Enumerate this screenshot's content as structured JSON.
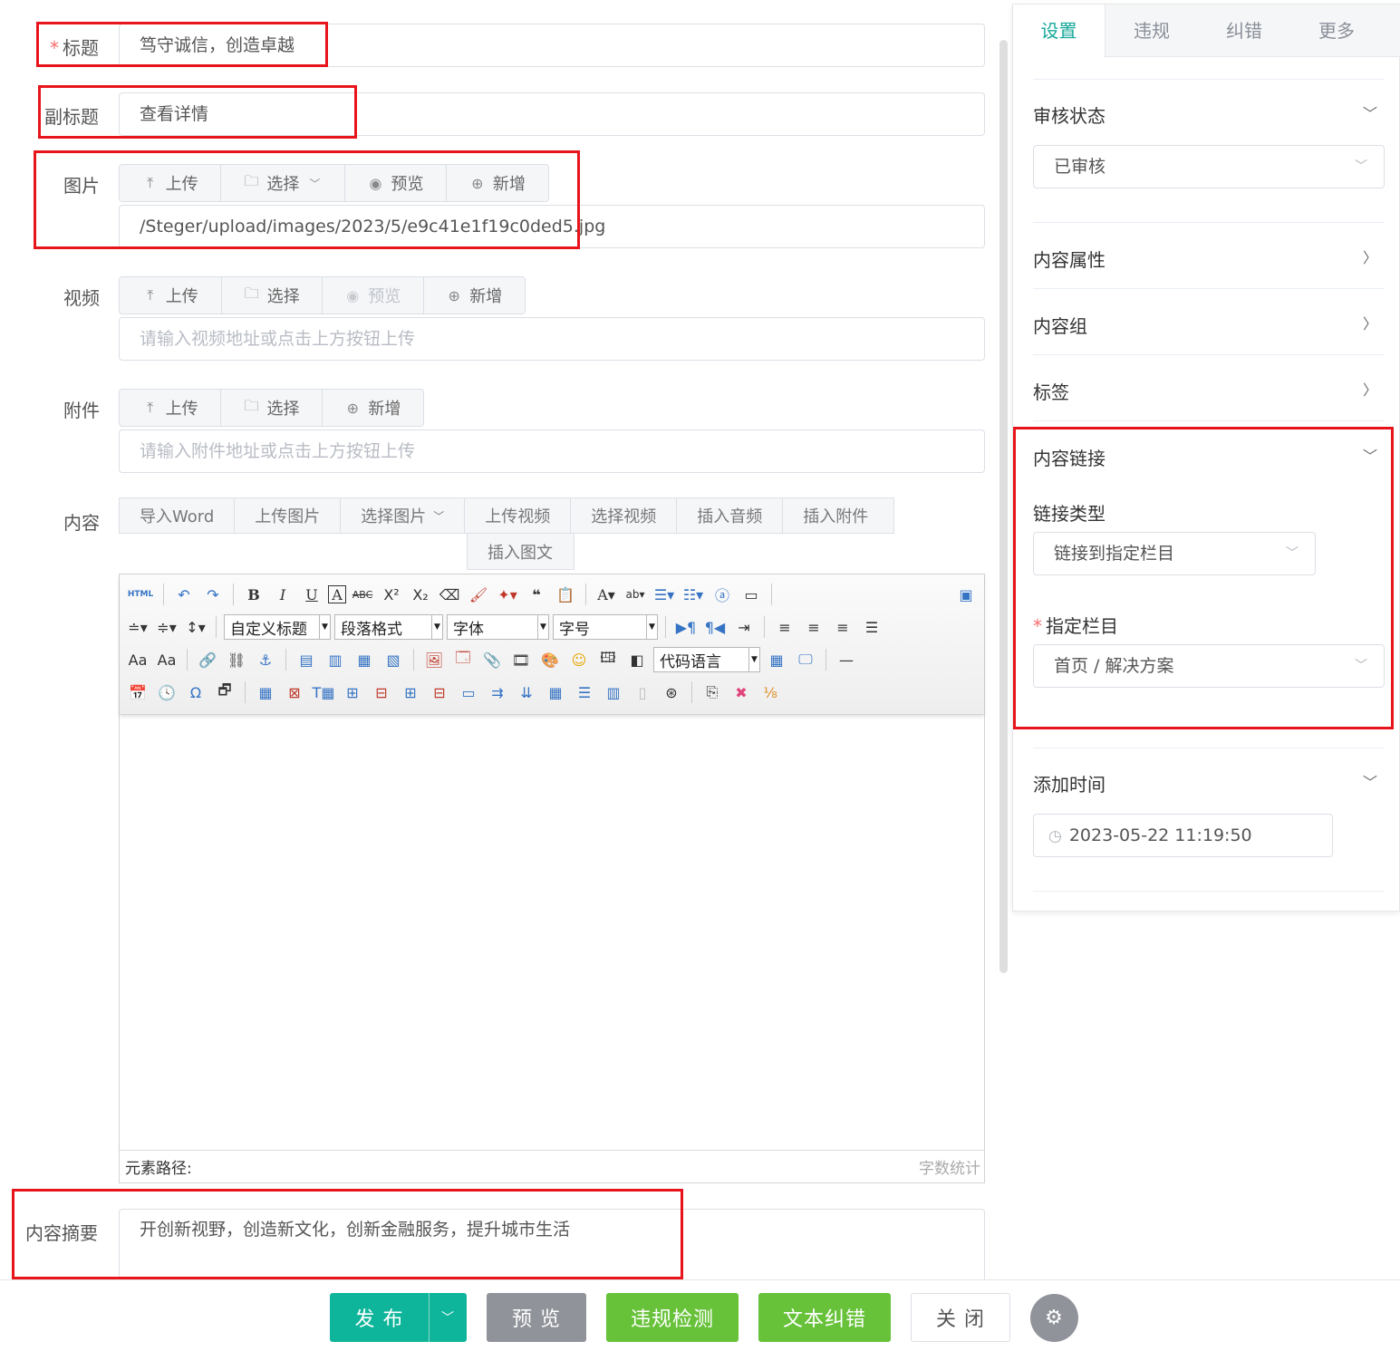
{
  "form": {
    "title_label": "标题",
    "title_value": "笃守诚信，创造卓越",
    "subtitle_label": "副标题",
    "subtitle_value": "查看详情",
    "image_label": "图片",
    "image_buttons": [
      "上传",
      "选择",
      "预览",
      "新增"
    ],
    "image_value": "/Steger/upload/images/2023/5/e9c41e1f19c0ded5.jpg",
    "video_label": "视频",
    "video_buttons": [
      "上传",
      "选择",
      "预览",
      "新增"
    ],
    "video_placeholder": "请输入视频地址或点击上方按钮上传",
    "attach_label": "附件",
    "attach_buttons": [
      "上传",
      "选择",
      "新增"
    ],
    "attach_placeholder": "请输入附件地址或点击上方按钮上传",
    "content_label": "内容",
    "content_buttons": [
      "导入Word",
      "上传图片",
      "选择图片",
      "上传视频",
      "选择视频",
      "插入音频",
      "插入附件"
    ],
    "content_button_row2": "插入图文",
    "summary_label": "内容摘要",
    "summary_value": "开创新视野，创造新文化，创新金融服务，提升城市生活"
  },
  "editor": {
    "html_label": "HTML",
    "heading_select": "自定义标题",
    "paragraph_select": "段落格式",
    "font_select": "字体",
    "size_select": "字号",
    "code_select": "代码语言",
    "element_path": "元素路径:",
    "word_count": "字数统计"
  },
  "panel": {
    "tabs": [
      "设置",
      "违规",
      "纠错",
      "更多"
    ],
    "review_status_label": "审核状态",
    "review_status_value": "已审核",
    "content_attr": "内容属性",
    "content_group": "内容组",
    "tags": "标签",
    "content_link": "内容链接",
    "link_type_label": "链接类型",
    "link_type_value": "链接到指定栏目",
    "target_column_label": "指定栏目",
    "target_column_value": "首页 / 解决方案",
    "add_time_label": "添加时间",
    "add_time_value": "2023-05-22 11:19:50"
  },
  "footer": {
    "publish": "发 布",
    "preview": "预 览",
    "violation_check": "违规检测",
    "text_correct": "文本纠错",
    "close": "关 闭"
  },
  "colors": {
    "accent": "#16a89a",
    "publish": "#0fb59a",
    "preview": "#909399",
    "check": "#67c23a",
    "annotation": "#e8141c"
  }
}
